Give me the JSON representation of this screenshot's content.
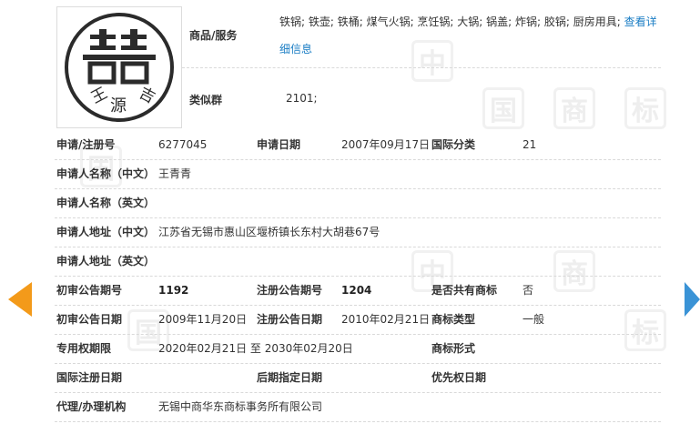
{
  "watermark": {
    "chars": [
      "中",
      "国",
      "商",
      "标"
    ]
  },
  "logo": {
    "bottom_left": "王",
    "bottom_center": "源",
    "bottom_right": "吉"
  },
  "goods": {
    "label": "商品/服务",
    "value": "铁锅; 铁壶; 铁桶; 煤气火锅; 烹饪锅; 大锅; 锅盖; 炸锅; 胶锅; 厨房用具;",
    "link": "查看详细信息"
  },
  "similar_group": {
    "label": "类似群",
    "value": "2101;"
  },
  "fields": {
    "app_no": {
      "label": "申请/注册号",
      "value": "6277045"
    },
    "app_date": {
      "label": "申请日期",
      "value": "2007年09月17日"
    },
    "intl_class": {
      "label": "国际分类",
      "value": "21"
    },
    "applicant_cn": {
      "label": "申请人名称（中文）",
      "value": "王青青"
    },
    "applicant_en": {
      "label": "申请人名称（英文）",
      "value": ""
    },
    "address_cn": {
      "label": "申请人地址（中文）",
      "value": "江苏省无锡市惠山区堰桥镇长东村大胡巷67号"
    },
    "address_en": {
      "label": "申请人地址（英文）",
      "value": ""
    },
    "prelim_issue": {
      "label": "初审公告期号",
      "value": "1192"
    },
    "reg_issue": {
      "label": "注册公告期号",
      "value": "1204"
    },
    "shared": {
      "label": "是否共有商标",
      "value": "否"
    },
    "prelim_date": {
      "label": "初审公告日期",
      "value": "2009年11月20日"
    },
    "reg_date": {
      "label": "注册公告日期",
      "value": "2010年02月21日"
    },
    "mark_type": {
      "label": "商标类型",
      "value": "一般"
    },
    "exclusive": {
      "label": "专用权期限",
      "value": "2020年02月21日 至 2030年02月20日"
    },
    "mark_form": {
      "label": "商标形式",
      "value": ""
    },
    "intl_reg_date": {
      "label": "国际注册日期",
      "value": ""
    },
    "later_date": {
      "label": "后期指定日期",
      "value": ""
    },
    "priority_date": {
      "label": "优先权日期",
      "value": ""
    },
    "agent": {
      "label": "代理/办理机构",
      "value": "无锡中商华东商标事务所有限公司"
    }
  },
  "nav": {
    "prev_icon": "arrow-left-icon",
    "next_icon": "arrow-right-icon"
  },
  "colors": {
    "accent_orange": "#f39a1a",
    "accent_blue": "#3a93d6",
    "link": "#1a7dc4"
  }
}
